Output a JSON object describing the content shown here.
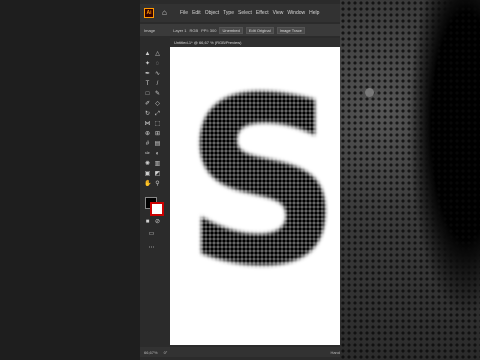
{
  "menubar": {
    "items": [
      "File",
      "Edit",
      "Object",
      "Type",
      "Select",
      "Effect",
      "View",
      "Window",
      "Help"
    ]
  },
  "control_bar": {
    "group_label": "Image",
    "layer_label": "Layer 1",
    "colorspace": "RGB",
    "ppi": "PPI: 300",
    "embed_button": "Unembed",
    "edit_button": "Edit Original",
    "trace_button": "Image Trace"
  },
  "document_tab": {
    "title": "Untitled-1* @ 66,67 % (RGB/Preview)"
  },
  "status_bar": {
    "zoom": "66,67%",
    "angle": "0°",
    "tool": "Hand"
  },
  "canvas": {
    "letter": "S"
  },
  "colors": {
    "accent": "#ff9a00",
    "fill": "#000000",
    "stroke": "#cc0000"
  }
}
